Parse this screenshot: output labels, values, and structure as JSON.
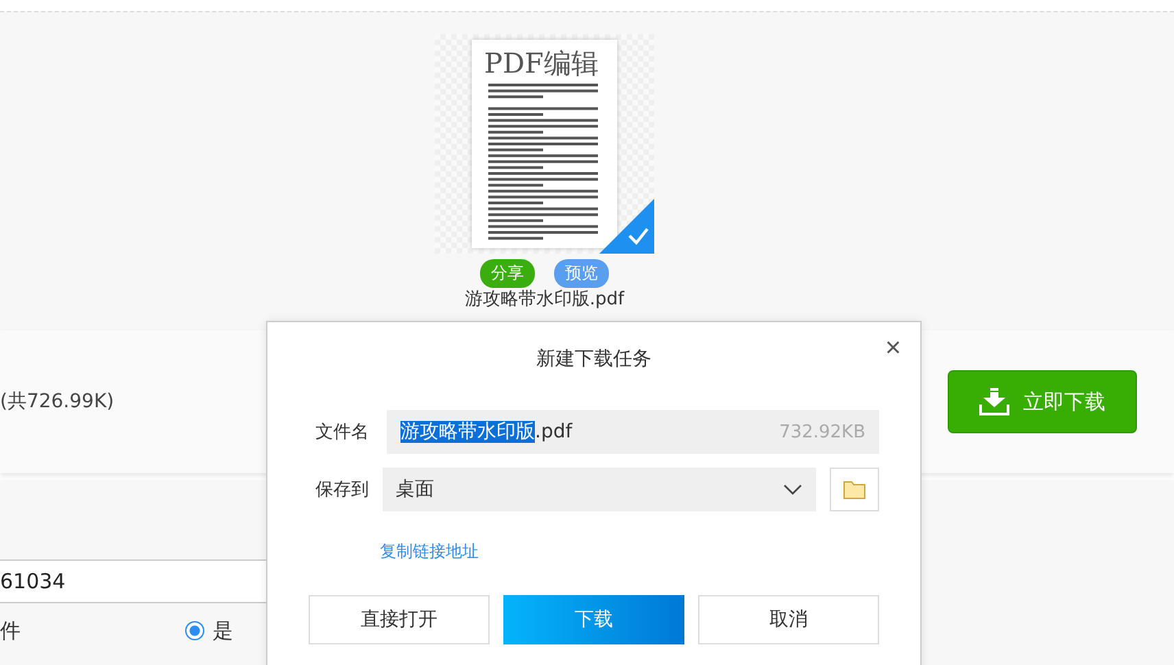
{
  "file_card": {
    "watermark": "PDF编辑",
    "checked": true,
    "share_label": "分享",
    "preview_label": "预览",
    "file_name": "游攻略带水印版.pdf"
  },
  "summary_bar": {
    "total": "(共726.99K)",
    "download_button": "立即下载"
  },
  "form": {
    "field_value": "61034",
    "row_label": "件",
    "radio": {
      "label": "是",
      "selected": true
    }
  },
  "dialog": {
    "title": "新建下载任务",
    "close": "×",
    "file_name_label": "文件名",
    "file_name_selected": "游攻略带水印版",
    "file_name_rest": ".pdf",
    "file_size": "732.92KB",
    "save_to_label": "保存到",
    "save_to_value": "桌面",
    "copy_link": "复制链接地址",
    "buttons": [
      {
        "label": "直接打开",
        "kind": "plain"
      },
      {
        "label": "下载",
        "kind": "primary"
      },
      {
        "label": "取消",
        "kind": "plain"
      }
    ]
  }
}
